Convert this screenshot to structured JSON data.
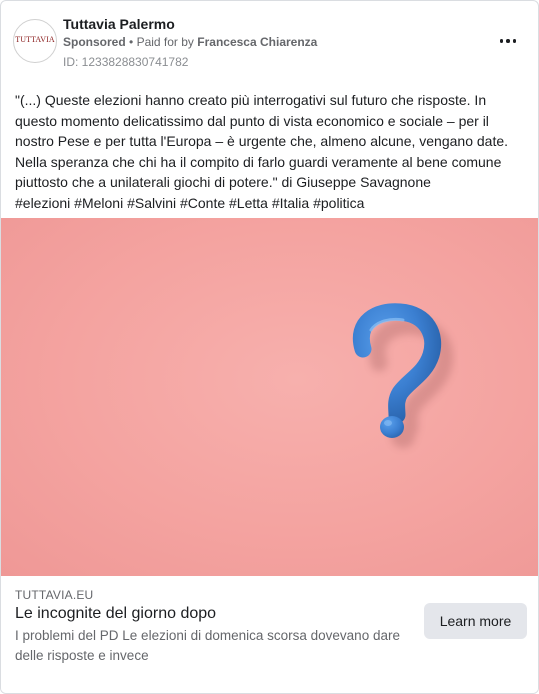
{
  "page": {
    "name": "Tuttavia Palermo",
    "avatar_text": "TUTTAVIA",
    "sponsored": "Sponsored",
    "separator": "•",
    "paid_for_by": "Paid for by",
    "payer": "Francesca Chiarenza",
    "ad_id": "ID: 1233828830741782"
  },
  "post": {
    "body": "\"(...) Queste elezioni hanno creato più interrogativi sul futuro che risposte. In questo momento delicatissimo dal punto di vista economico e sociale – per il nostro Pese e per tutta l'Europa – è urgente che, almeno alcune, vengano date. Nella speranza che chi ha il compito di farlo guardi veramente al bene comune piuttosto che a unilaterali giochi di potere.\" di Giuseppe Savagnone",
    "hashtags": "#elezioni #Meloni #Salvini #Conte #Letta #Italia #politica"
  },
  "image": {
    "icon": "question-mark-icon",
    "background_color": "#f4a3a0",
    "icon_color": "#3b7fd1"
  },
  "link": {
    "domain": "TUTTAVIA.EU",
    "title": "Le incognite del giorno dopo",
    "description": "I problemi del PD Le elezioni di domenica scorsa dovevano dare delle risposte e invece",
    "cta_label": "Learn more"
  },
  "colors": {
    "text_primary": "#1c1e21",
    "text_secondary": "#65676b",
    "button_bg": "#e4e6eb"
  }
}
